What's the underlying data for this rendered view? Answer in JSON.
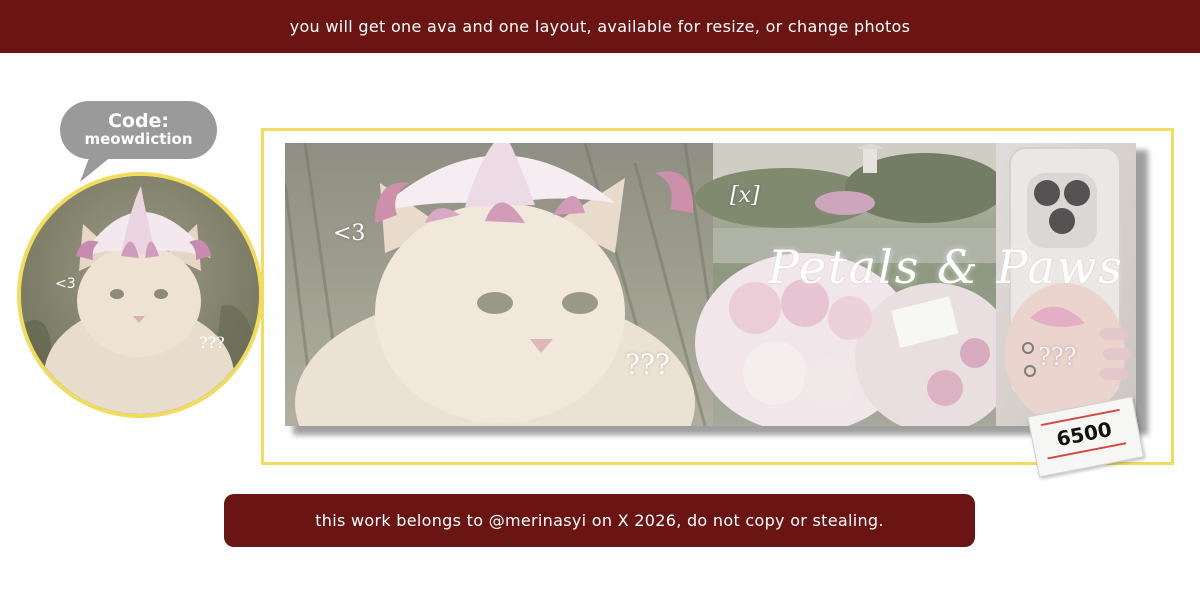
{
  "top_banner": {
    "text": "you will get one ava and one layout, available for resize, or change photos"
  },
  "bubble": {
    "line1": "Code:",
    "line2": "meowdiction"
  },
  "avatar": {
    "heart_text": "<3",
    "question_text": "???"
  },
  "banner": {
    "heart_text": "<3",
    "question_text": "???",
    "bracket_text": "[x]",
    "title": "Petals & Paws",
    "phone_text": "???"
  },
  "price_tag": {
    "price": "6500"
  },
  "bottom_banner": {
    "text": "this work belongs to @merinasyi on X 2026, do not copy or stealing."
  },
  "colors": {
    "maroon": "#6b1414",
    "frame_yellow": "#f2dc5d",
    "bubble_gray": "#9a9a9a"
  }
}
